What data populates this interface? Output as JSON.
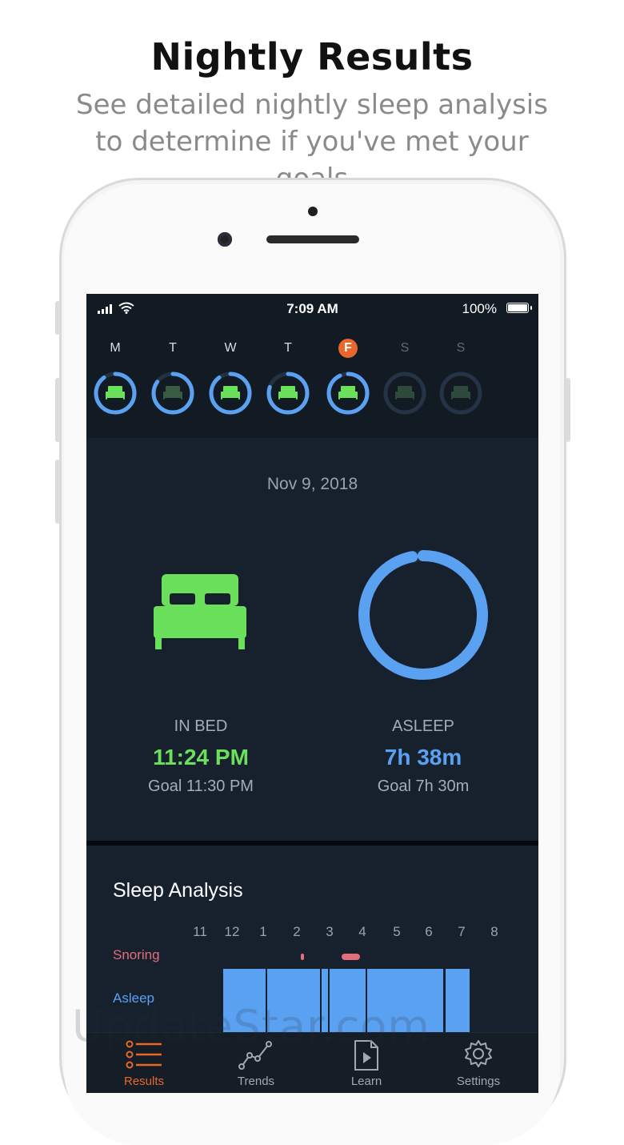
{
  "promo": {
    "headline": "Nightly Results",
    "subline": "See detailed nightly sleep analysis to determine if you've met your goals"
  },
  "status_bar": {
    "time": "7:09 AM",
    "battery": "100%"
  },
  "week": [
    {
      "label": "M",
      "progress": 0.9,
      "state": "done"
    },
    {
      "label": "T",
      "progress": 0.85,
      "state": "missed"
    },
    {
      "label": "W",
      "progress": 0.9,
      "state": "done"
    },
    {
      "label": "T",
      "progress": 0.8,
      "state": "done"
    },
    {
      "label": "F",
      "progress": 0.93,
      "state": "today"
    },
    {
      "label": "S",
      "progress": 0,
      "state": "future"
    },
    {
      "label": "S",
      "progress": 0,
      "state": "future"
    }
  ],
  "summary": {
    "date": "Nov 9, 2018",
    "in_bed": {
      "label": "IN BED",
      "value": "11:24 PM",
      "goal": "Goal 11:30 PM"
    },
    "asleep": {
      "label": "ASLEEP",
      "value": "7h 38m",
      "goal": "Goal 7h 30m",
      "progress": 0.97
    }
  },
  "analysis": {
    "title": "Sleep Analysis",
    "hours": [
      "11",
      "12",
      "1",
      "2",
      "3",
      "4",
      "5",
      "6",
      "7",
      "8"
    ],
    "rows": {
      "snoring": "Snoring",
      "asleep": "Asleep"
    }
  },
  "tabs": [
    {
      "label": "Results",
      "active": true
    },
    {
      "label": "Trends",
      "active": false
    },
    {
      "label": "Learn",
      "active": false
    },
    {
      "label": "Settings",
      "active": false
    }
  ],
  "watermark": "UpdateStar.com",
  "colors": {
    "green": "#6be05a",
    "blue": "#5aa1f1",
    "orange": "#e8672a",
    "snore": "#e36d7a",
    "background": "#17212e"
  }
}
